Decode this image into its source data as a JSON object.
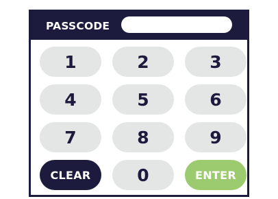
{
  "header": {
    "label": "PASSCODE",
    "passcode_value": "",
    "passcode_placeholder": ""
  },
  "keys": {
    "k1": "1",
    "k2": "2",
    "k3": "3",
    "k4": "4",
    "k5": "5",
    "k6": "6",
    "k7": "7",
    "k8": "8",
    "k9": "9",
    "k0": "0",
    "clear": "CLEAR",
    "enter": "ENTER"
  },
  "colors": {
    "dark_navy": "#1c1b3d",
    "key_gray": "#e4e6e6",
    "enter_green": "#9ccb6f",
    "white": "#ffffff"
  }
}
